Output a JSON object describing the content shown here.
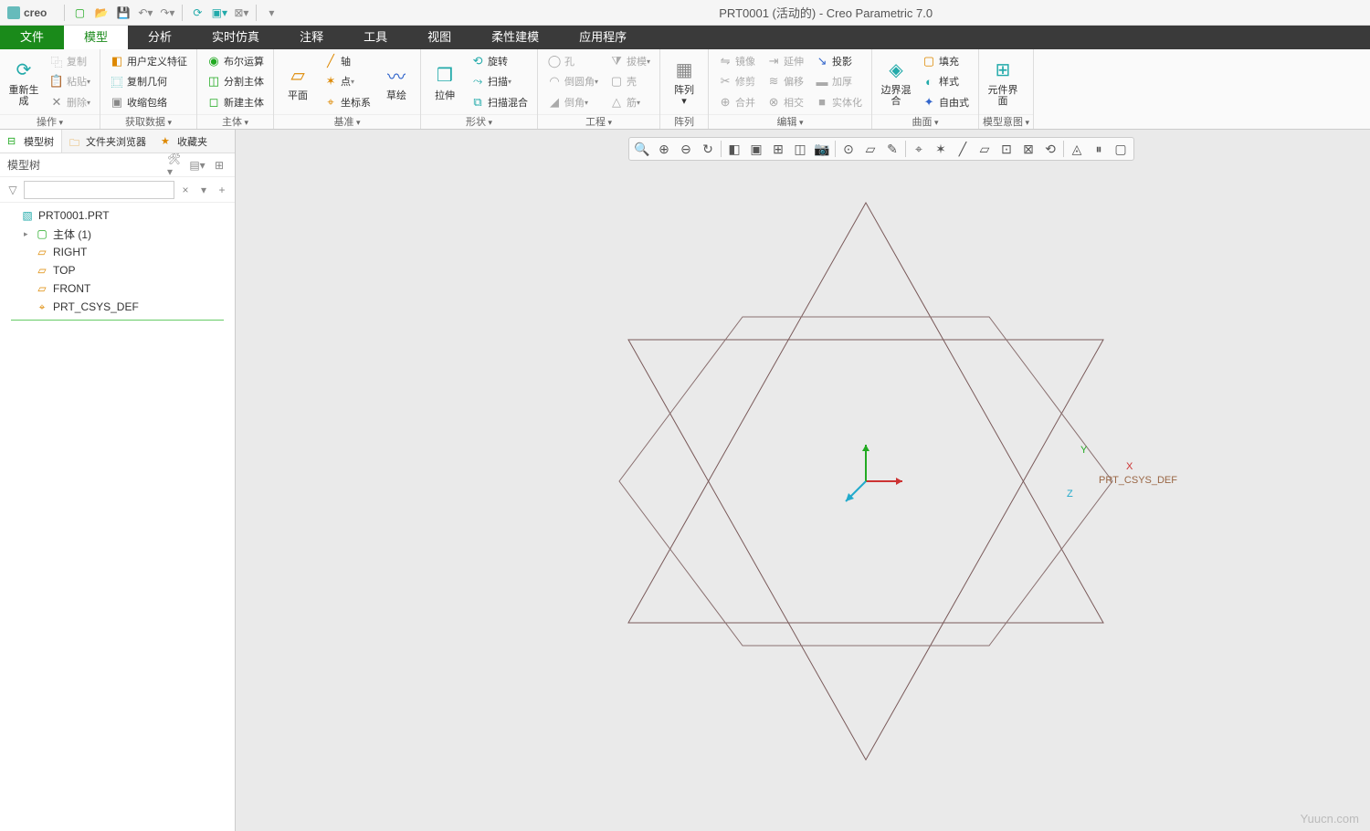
{
  "app": {
    "logo": "creo",
    "title": "PRT0001 (活动的) - Creo Parametric 7.0"
  },
  "tabs": {
    "file": "文件",
    "items": [
      "模型",
      "分析",
      "实时仿真",
      "注释",
      "工具",
      "视图",
      "柔性建模",
      "应用程序"
    ],
    "active": 0
  },
  "ribbon": {
    "g0": {
      "label": "操作",
      "regen": "重新生成",
      "copy": "复制",
      "paste": "粘贴",
      "delete": "删除"
    },
    "g1": {
      "label": "获取数据",
      "udf": "用户定义特征",
      "copygeom": "复制几何",
      "shrinkwrap": "收缩包络"
    },
    "g2": {
      "label": "主体",
      "bool": "布尔运算",
      "split": "分割主体",
      "newbody": "新建主体"
    },
    "g3": {
      "label": "基准",
      "plane": "平面",
      "axis": "轴",
      "point": "点",
      "csys": "坐标系",
      "sketch": "草绘"
    },
    "g4": {
      "label": "形状",
      "extrude": "拉伸",
      "revolve": "旋转",
      "sweep": "扫描",
      "sweepblend": "扫描混合"
    },
    "g5": {
      "label": "工程",
      "hole": "孔",
      "round": "倒圆角",
      "chamfer": "倒角",
      "draft": "拔模",
      "shell": "壳",
      "rib": "筋"
    },
    "g6": {
      "label": "阵列",
      "pattern": "阵列"
    },
    "g7": {
      "label": "编辑",
      "mirror": "镜像",
      "trim": "修剪",
      "merge": "合并",
      "extend": "延伸",
      "offset": "偏移",
      "intersect": "相交",
      "proj": "投影",
      "thicken": "加厚",
      "solidify": "实体化"
    },
    "g8": {
      "label": "曲面",
      "boundary": "边界混合",
      "fill": "填充",
      "style": "样式",
      "freestyle": "自由式"
    },
    "g9": {
      "label": "模型意图",
      "ci": "元件界面"
    }
  },
  "sidebar": {
    "tabs": [
      "模型树",
      "文件夹浏览器",
      "收藏夹"
    ],
    "treeTitle": "模型树",
    "searchPlaceholder": "",
    "items": [
      {
        "name": "PRT0001.PRT",
        "type": "part",
        "indent": 0,
        "expand": ""
      },
      {
        "name": "主体 (1)",
        "type": "body",
        "indent": 1,
        "expand": "▸"
      },
      {
        "name": "RIGHT",
        "type": "plane",
        "indent": 1,
        "expand": ""
      },
      {
        "name": "TOP",
        "type": "plane",
        "indent": 1,
        "expand": ""
      },
      {
        "name": "FRONT",
        "type": "plane",
        "indent": 1,
        "expand": ""
      },
      {
        "name": "PRT_CSYS_DEF",
        "type": "csys",
        "indent": 1,
        "expand": ""
      }
    ]
  },
  "canvas": {
    "csysLabel": "PRT_CSYS_DEF",
    "axes": {
      "x": "X",
      "y": "Y",
      "z": "Z"
    },
    "watermark": "Yuucn.com"
  }
}
